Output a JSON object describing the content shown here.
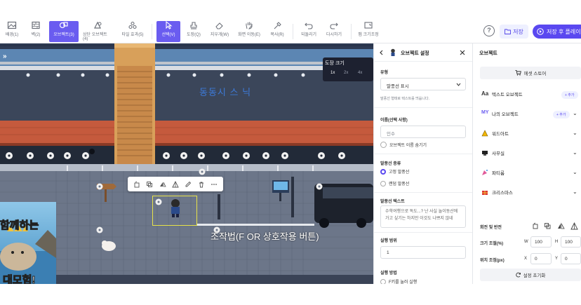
{
  "toolbar": {
    "tools": [
      {
        "label": "배경(1)",
        "icon": "image-icon",
        "active": false
      },
      {
        "label": "벽(2)",
        "icon": "wall-icon",
        "active": false
      },
      {
        "label": "오브젝트(3)",
        "icon": "object-icon",
        "active": true
      },
      {
        "label": "상단 오브젝트(4)",
        "icon": "top-object-icon",
        "active": false
      },
      {
        "label": "타일 효과(5)",
        "icon": "tile-effect-icon",
        "active": false
      },
      {
        "label": "선택(V)",
        "icon": "cursor-icon",
        "active": true
      },
      {
        "label": "도장(Q)",
        "icon": "stamp-icon",
        "active": false
      },
      {
        "label": "지우개(W)",
        "icon": "eraser-icon",
        "active": false
      },
      {
        "label": "화면 이동(E)",
        "icon": "hand-icon",
        "active": false
      },
      {
        "label": "복사(R)",
        "icon": "eyedropper-icon",
        "active": false
      },
      {
        "label": "되돌리기",
        "icon": "undo-icon",
        "active": false
      },
      {
        "label": "다시하기",
        "icon": "redo-icon",
        "active": false
      },
      {
        "label": "맵 크기조정",
        "icon": "resize-icon",
        "active": false
      }
    ],
    "help_label": "?",
    "save_label": "저장",
    "play_label": "저장 후 플레이"
  },
  "canvas": {
    "banner_text": "동동시 스 닉",
    "zoom_title": "도장 크기",
    "zoom_options": [
      "1x",
      "2x",
      "4x"
    ],
    "zoom_selected": "1x",
    "subtitle": "조작법(F OR 상호작용 버튼)",
    "ad_text_top": "함께하는",
    "ad_text_bottom": "대모험!"
  },
  "settings_panel": {
    "title": "오브젝트 설정",
    "type_label": "유형",
    "type_value": "말풍선 표시",
    "type_help": "말풍선 형태로 텍스트를 띄웁니다.",
    "name_label": "이름(선택 사항)",
    "name_placeholder": "인수",
    "hide_name_label": "오브젝트 이름 숨기기",
    "bubble_type_label": "말풍선 종류",
    "bubble_options": [
      {
        "label": "고정 말풍선",
        "selected": true
      },
      {
        "label": "랜덤 말풍선",
        "selected": false
      }
    ],
    "bubble_text_label": "말풍선 텍스트",
    "bubble_text": "수학여행으로 독도...? 난 사실 놀이동산에 가고 싶기는 하지만 이것도 나쁘지 않네",
    "range_label": "실행 범위",
    "range_value": "1",
    "method_label": "실행 방법",
    "method_option": "F키를 눌러 실행"
  },
  "library_panel": {
    "title": "오브젝트",
    "asset_store_label": "에셋 스토어",
    "items": [
      {
        "label": "텍스트 오브젝트",
        "icon": "text-aa-icon",
        "add": "+ 추가",
        "chevron": false
      },
      {
        "label": "나의 오브젝트",
        "icon": "my-object-icon",
        "add": "+ 추가",
        "chevron": true
      },
      {
        "label": "워드아트",
        "icon": "wordart-icon",
        "add": "",
        "chevron": true
      },
      {
        "label": "사무실",
        "icon": "office-icon",
        "add": "",
        "chevron": true
      },
      {
        "label": "파티룸",
        "icon": "party-icon",
        "add": "",
        "chevron": true
      },
      {
        "label": "크리스마스",
        "icon": "christmas-icon",
        "add": "",
        "chevron": true
      }
    ],
    "rotate_label": "회전 및 반전",
    "size_label": "크기 조절(%)",
    "size_w_label": "W",
    "size_w_value": "100",
    "size_h_label": "H",
    "size_h_value": "100",
    "pos_label": "위치 조정(px)",
    "pos_x_label": "X",
    "pos_x_value": "0",
    "pos_y_label": "Y",
    "pos_y_value": "0",
    "reset_label": "설정 초기화"
  }
}
